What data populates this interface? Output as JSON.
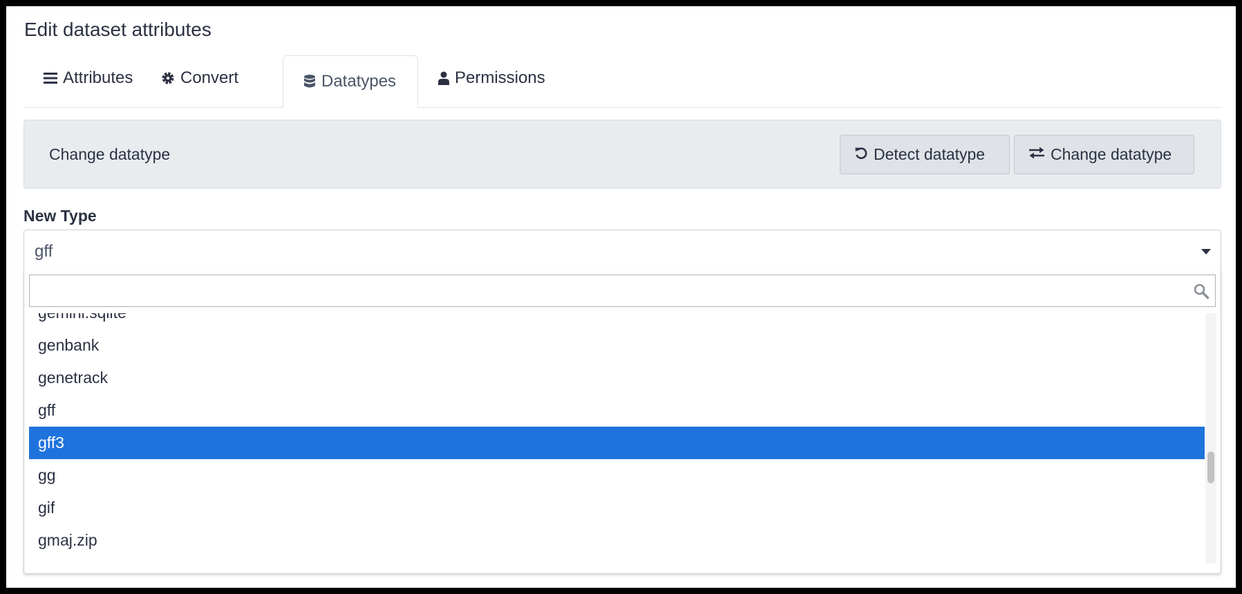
{
  "page": {
    "title": "Edit dataset attributes"
  },
  "tabs": [
    {
      "label": "Attributes",
      "icon": "bars-icon",
      "active": false
    },
    {
      "label": "Convert",
      "icon": "gear-icon",
      "active": false
    },
    {
      "label": "Datatypes",
      "icon": "database-icon",
      "active": true
    },
    {
      "label": "Permissions",
      "icon": "user-icon",
      "active": false
    }
  ],
  "panel": {
    "label": "Change datatype",
    "detect_button": "Detect datatype",
    "change_button": "Change datatype"
  },
  "field": {
    "label": "New Type",
    "selected_value": "gff",
    "search_placeholder": ""
  },
  "options": [
    {
      "label": "gemini.sqlite"
    },
    {
      "label": "genbank"
    },
    {
      "label": "genetrack"
    },
    {
      "label": "gff"
    },
    {
      "label": "gff3",
      "highlighted": true
    },
    {
      "label": "gg"
    },
    {
      "label": "gif"
    },
    {
      "label": "gmaj.zip"
    }
  ],
  "colors": {
    "highlight": "#1f73dc",
    "panel_bg": "#e8ecef",
    "text": "#2c3143"
  }
}
